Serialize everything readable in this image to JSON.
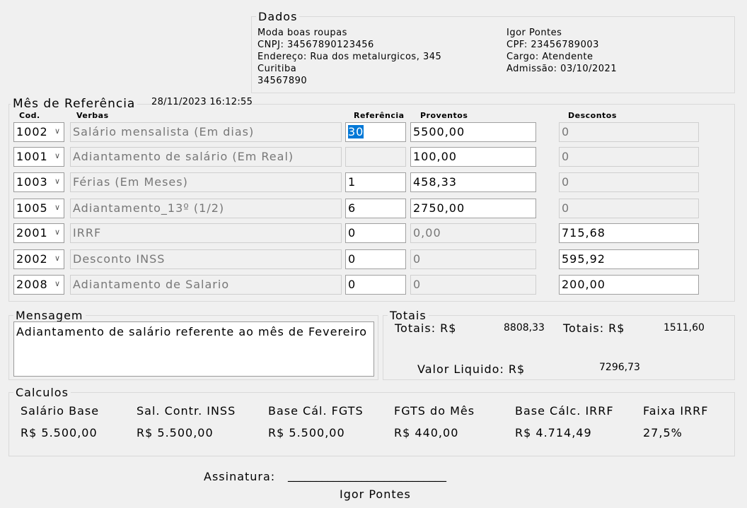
{
  "dados": {
    "legend": "Dados",
    "company": [
      "Moda boas roupas",
      "CNPJ: 34567890123456",
      "Endereço: Rua dos metalurgicos, 345",
      "Curitiba",
      "34567890"
    ],
    "employee": [
      "Igor Pontes",
      "CPF: 23456789003",
      "Cargo: Atendente",
      "Admissão: 03/10/2021"
    ]
  },
  "referencia": {
    "legend": "Mês de Referência",
    "datetime": "28/11/2023 16:12:55",
    "headers": {
      "cod": "Cod.",
      "verbas": "Verbas",
      "referencia": "Referência",
      "proventos": "Proventos",
      "descontos": "Descontos"
    },
    "rows": [
      {
        "cod": "1002",
        "verba": "Salário mensalista (Em dias)",
        "ref": "30",
        "prov": "5500,00",
        "desc": "0"
      },
      {
        "cod": "1001",
        "verba": "Adiantamento de salário (Em Real)",
        "ref": "",
        "prov": "100,00",
        "desc": "0"
      },
      {
        "cod": "1003",
        "verba": "Férias (Em Meses)",
        "ref": "1",
        "prov": "458,33",
        "desc": "0"
      },
      {
        "cod": "1005",
        "verba": "Adiantamento_13º (1/2)",
        "ref": "6",
        "prov": "2750,00",
        "desc": "0"
      },
      {
        "cod": "2001",
        "verba": "IRRF",
        "ref": "0",
        "prov": "0,00",
        "desc": "715,68"
      },
      {
        "cod": "2002",
        "verba": "Desconto INSS",
        "ref": "0",
        "prov": "0",
        "desc": "595,92"
      },
      {
        "cod": "2008",
        "verba": "Adiantamento de Salario",
        "ref": "0",
        "prov": "0",
        "desc": "200,00"
      }
    ]
  },
  "mensagem": {
    "legend": "Mensagem",
    "text": "Adiantamento de salário referente ao mês de Fevereiro"
  },
  "totais": {
    "legend": "Totais",
    "label_prov": "Totais: R$",
    "value_prov": "8808,33",
    "label_desc": "Totais: R$",
    "value_desc": "1511,60",
    "label_liquido": "Valor Liquido: R$",
    "value_liquido": "7296,73"
  },
  "calculos": {
    "legend": "Calculos",
    "items": [
      {
        "label": "Salário Base",
        "value": "R$ 5.500,00"
      },
      {
        "label": "Sal. Contr. INSS",
        "value": "R$ 5.500,00"
      },
      {
        "label": "Base Cál. FGTS",
        "value": "R$ 5.500,00"
      },
      {
        "label": "FGTS do Mês",
        "value": "R$ 440,00"
      },
      {
        "label": "Base Cálc. IRRF",
        "value": "R$ 4.714,49"
      },
      {
        "label": "Faixa IRRF",
        "value": "27,5%"
      }
    ]
  },
  "assinatura": {
    "label": "Assinatura:",
    "line": "____________________________",
    "name": "Igor Pontes"
  }
}
